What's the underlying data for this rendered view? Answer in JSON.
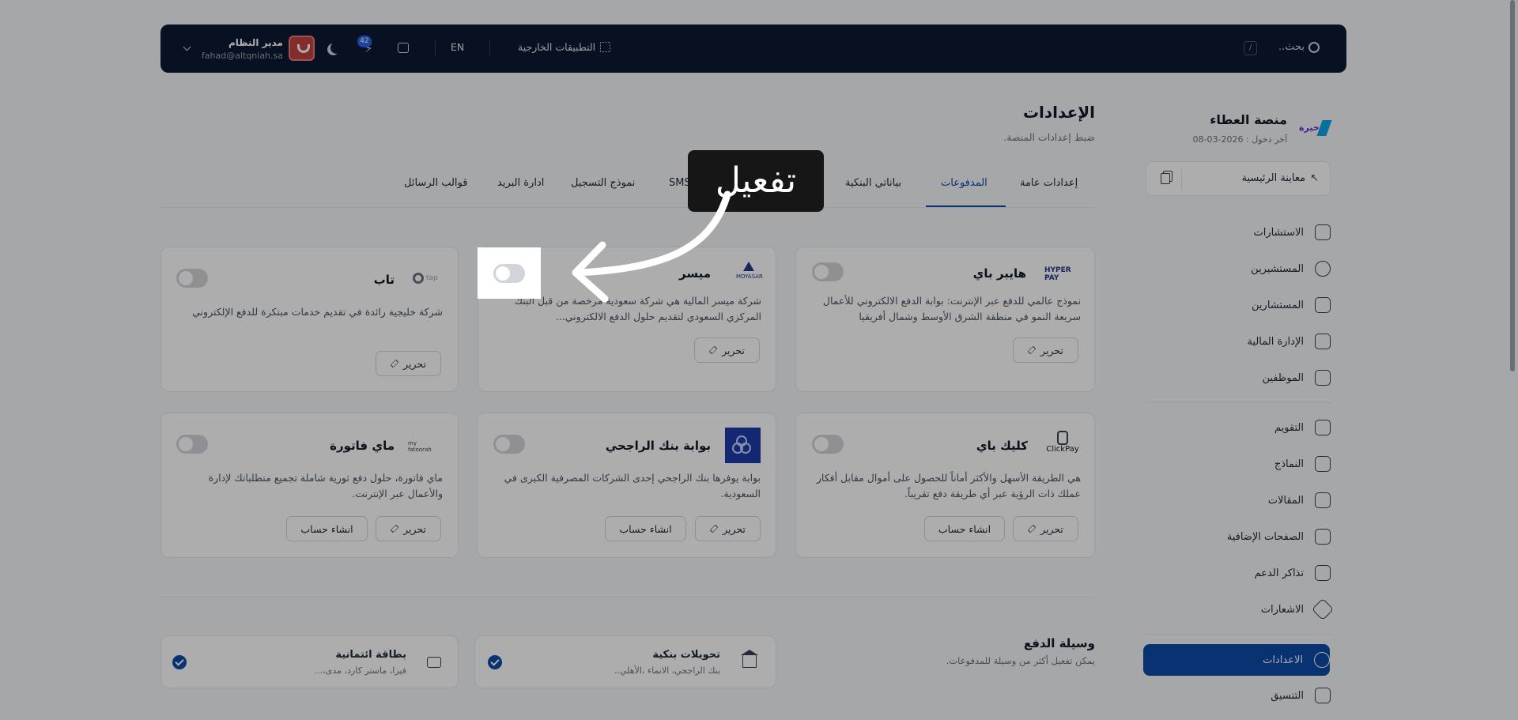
{
  "topbar": {
    "search_placeholder": "بحث..",
    "search_shortcut": "/",
    "external_apps": "التطبيقات الخارجية",
    "language": "EN",
    "notifications_count": "42",
    "user_name": "مدير النظام",
    "user_email": "fahad@altqniah.sa"
  },
  "sidebar": {
    "org_name": "منصة العطاء",
    "last_login": "آخر دخول : 2026-03-08",
    "preview_label": "معاينة الرئيسية",
    "items": [
      {
        "label": "الاستشارات"
      },
      {
        "label": "المستشيرين"
      },
      {
        "label": "المستشارين"
      },
      {
        "label": "الإدارة المالية"
      },
      {
        "label": "الموظفين"
      },
      {
        "label": "التقويم"
      },
      {
        "label": "النماذج"
      },
      {
        "label": "المقالات"
      },
      {
        "label": "الصفحات الإضافية"
      },
      {
        "label": "تذاكر الدعم"
      },
      {
        "label": "الاشعارات"
      },
      {
        "label": "الاعدادات"
      },
      {
        "label": "التنسيق"
      }
    ]
  },
  "page": {
    "title": "الإعدادات",
    "subtitle": "ضبط إعدادات المنصة."
  },
  "tabs": [
    {
      "label": "إعدادات عامة"
    },
    {
      "label": "المدفوعات"
    },
    {
      "label": "بياناتي البنكية"
    },
    {
      "label": "بوابة SMS"
    },
    {
      "label": "نموذج التسجيل"
    },
    {
      "label": "ادارة البريد"
    },
    {
      "label": "قوالب الرسائل"
    }
  ],
  "gateways": {
    "hyperpay": {
      "name": "هايبر باي",
      "logo_text": "HYPER PAY",
      "desc": "نموذج عالمي للدفع عبر الإنترنت: بوابة الدفع الالكتروني للأعمال سريعة النمو في منطقة الشرق الأوسط وشمال أفريقيا",
      "edit": "تحرير"
    },
    "moyasar": {
      "name": "ميسر",
      "logo_text": "MOYASAR",
      "desc": "شركة ميسر المالية هي شركة سعودية مرخصة من قبل البنك المركزي السعودي لتقديم حلول الدفع الالكتروني...",
      "edit": "تحرير"
    },
    "tap": {
      "name": "تاب",
      "logo_text": "tap",
      "desc": "شركة خليجية رائدة في تقديم خدمات مبتكرة للدفع الإلكتروني",
      "edit": "تحرير"
    },
    "clickpay": {
      "name": "كليك باي",
      "logo_text": "ClickPay",
      "desc": "هي الطريقة الأسهل والأكثر أماناً للحصول على أموال مقابل أفكار عملك ذات الرؤية عبر أي طريقة دفع تقريباً.",
      "edit": "تحرير",
      "create": "انشاء حساب"
    },
    "rajhi": {
      "name": "بوابة بنك الراجحي",
      "desc": "بوابة يوفرها بنك الراجحي إحدى الشركات المصرفية الكبرى في السعودية.",
      "edit": "تحرير",
      "create": "انشاء حساب"
    },
    "myfatoorah": {
      "name": "ماي فاتورة",
      "logo_text": "my fatoorah",
      "desc": "ماي فاتورة، حلول دفع ثورية شاملة تجميع متطلباتك لإدارة والأعمال عبر الإنترنت.",
      "edit": "تحرير",
      "create": "انشاء حساب"
    }
  },
  "payment_methods": {
    "title": "وسيلة الدفع",
    "subtitle": "يمكن تفعيل أكثر من وسيلة للمدفوعات.",
    "bank_transfer": {
      "name": "تحويلات بنكية",
      "desc": "بنك الراجحي، الانماء ،الأهلي.."
    },
    "credit_card": {
      "name": "بطاقة ائتمانية",
      "desc": "فيزا، ماستر كارد، مدى،..."
    }
  },
  "tooltip": {
    "text": "تفعيل"
  },
  "colors": {
    "accent": "#0c4aa8",
    "topbar": "#0b1a33"
  }
}
